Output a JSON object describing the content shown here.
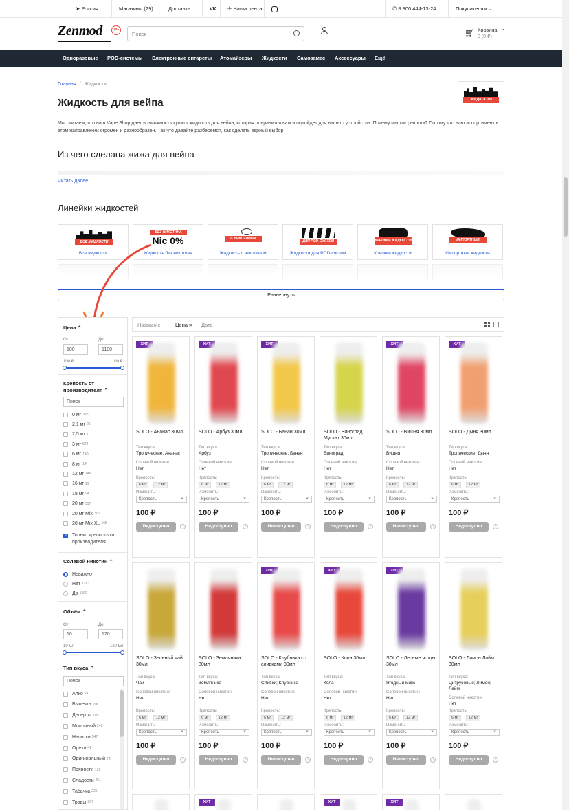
{
  "topbar": {
    "city": "Россия",
    "stores": "Магазины (29)",
    "delivery": "Доставка",
    "vk": "VK",
    "telegram": "Наша лента",
    "phone": "8 800 444-13-24",
    "buyers": "Покупателям"
  },
  "header": {
    "logo": "Zenmod",
    "age": "18+",
    "search_placeholder": "Поиск",
    "cart_label": "Корзина",
    "cart_sum": "0 (0 ₽)"
  },
  "nav": [
    "Одноразовые",
    "POD-системы",
    "Электронные сигареты",
    "Атомайзеры",
    "Жидкости",
    "Самозамес",
    "Аксессуары",
    "Ещё"
  ],
  "breadcrumb": {
    "home": "Главная",
    "sep": "/",
    "current": "Жидкости"
  },
  "category_badge": "ЖИДКОСТИ",
  "page_title": "Жидкость для вейпа",
  "intro": "Мы считаем, что наш Vape Shop дает возможность купить жидкость для вейпа, которая понравится вам и подойдет для вашего устройства. Почему мы так решили? Потому что наш ассортимент в этом направлении огромен и разнообразен. Так что давайте разберемся, как сделать верный выбор.",
  "section_heading": "Из чего сделана жижа для вейпа",
  "read_more": "Читать далее",
  "series_title": "Линейки жидкостей",
  "series": [
    {
      "label": "Все жидкости",
      "badge": "ВСЕ ЖИДКОСТИ"
    },
    {
      "label": "Жидкость без никотина",
      "badge": "БЕЗ НИКОТИНА",
      "big": "Nic 0%"
    },
    {
      "label": "Жидкость с никотином",
      "badge": "С НИКОТИНОМ"
    },
    {
      "label": "Жидкости для POD-систем",
      "badge": "ДЛЯ POD-СИСТЕМ"
    },
    {
      "label": "Крепкие жидкости",
      "badge": "КРЕПКИЕ ЖИДКОСТИ"
    },
    {
      "label": "Импортные жидкости",
      "badge": "ИМПОРТНЫЕ"
    }
  ],
  "expand_button": "Развернуть",
  "filters": {
    "price": {
      "title": "Цена",
      "from_label": "От",
      "to_label": "До",
      "from": "100",
      "to": "1100",
      "min_label": "100 ₽",
      "max_label": "1100 ₽"
    },
    "strength": {
      "title": "Крепость от производителя",
      "search_placeholder": "Поиск",
      "items": [
        {
          "label": "0 мг",
          "count": "325"
        },
        {
          "label": "2,1 мг",
          "count": "26"
        },
        {
          "label": "2,5 мг",
          "count": "1"
        },
        {
          "label": "3 мг",
          "count": "544"
        },
        {
          "label": "6 мг",
          "count": "140"
        },
        {
          "label": "8 мг",
          "count": "14"
        },
        {
          "label": "12 мг",
          "count": "146"
        },
        {
          "label": "16 мг",
          "count": "29"
        },
        {
          "label": "18 мг",
          "count": "94"
        },
        {
          "label": "20 мг",
          "count": "597"
        },
        {
          "label": "20 мг Mix",
          "count": "307"
        },
        {
          "label": "20 мг Mix XL",
          "count": "165"
        }
      ],
      "only_label": "Только крепость от производителя"
    },
    "salt": {
      "title": "Солевой никотин",
      "items": [
        {
          "label": "Неважно",
          "count": ""
        },
        {
          "label": "Нет",
          "count": "1283"
        },
        {
          "label": "Да",
          "count": "1290"
        }
      ]
    },
    "volume": {
      "title": "Объём",
      "from_label": "От",
      "to_label": "До",
      "from": "10",
      "to": "120",
      "min_label": "10 мл",
      "max_label": "120 мл"
    },
    "taste": {
      "title": "Тип вкуса",
      "search_placeholder": "Поиск",
      "items": [
        {
          "label": "Алко",
          "count": "24"
        },
        {
          "label": "Выпечка",
          "count": "206"
        },
        {
          "label": "Десерты",
          "count": "105"
        },
        {
          "label": "Молочный",
          "count": "242"
        },
        {
          "label": "Напитки",
          "count": "547"
        },
        {
          "label": "Орехи",
          "count": "41"
        },
        {
          "label": "Оригинальный",
          "count": "78"
        },
        {
          "label": "Пряности",
          "count": "139"
        },
        {
          "label": "Сладости",
          "count": "451"
        },
        {
          "label": "Табачка",
          "count": "225"
        },
        {
          "label": "Травы",
          "count": "307"
        }
      ]
    }
  },
  "sort": {
    "name": "Название",
    "price": "Цена",
    "date": "Дата"
  },
  "product_labels": {
    "taste": "Тип вкуса:",
    "salt": "Солевой никотин:",
    "strength": "Крепость:",
    "change": "Изменить:",
    "select": "Крепость",
    "unavailable": "Недоступно",
    "q": "?",
    "hit": "ХИТ"
  },
  "products_row1": [
    {
      "name": "SOLO - Ананас 30мл",
      "taste": "Тропические; Ананас",
      "salt": "Нет",
      "price": "100 ₽",
      "hit": true,
      "color": "#f0b63c"
    },
    {
      "name": "SOLO - Арбуз 30мл",
      "taste": "Арбуз",
      "salt": "Нет",
      "price": "100 ₽",
      "hit": true,
      "color": "#e0484f"
    },
    {
      "name": "SOLO - Банан 30мл",
      "taste": "Тропические; Банан",
      "salt": "Нет",
      "price": "100 ₽",
      "hit": true,
      "color": "#f2c84a"
    },
    {
      "name": "SOLO - Виноград Мускат 30мл",
      "taste": "Виноград",
      "salt": "Нет",
      "price": "100 ₽",
      "hit": false,
      "color": "#d6d44a"
    },
    {
      "name": "SOLO - Вишня 30мл",
      "taste": "Вишня",
      "salt": "Нет",
      "price": "100 ₽",
      "hit": true,
      "color": "#e04664"
    },
    {
      "name": "SOLO - Дыня 30мл",
      "taste": "Тропические; Дыня",
      "salt": "Нет",
      "price": "100 ₽",
      "hit": true,
      "color": "#f0a070"
    }
  ],
  "products_row2": [
    {
      "name": "SOLO - Зеленый чай 30мл",
      "taste": "Чай",
      "salt": "Нет",
      "price": "100 ₽",
      "hit": false,
      "color": "#c9a83a"
    },
    {
      "name": "SOLO - Земляника 30мл",
      "taste": "Земляника",
      "salt": "Нет",
      "price": "100 ₽",
      "hit": false,
      "color": "#d23a3a"
    },
    {
      "name": "SOLO - Клубника со сливками 30мл",
      "taste": "Сливки; Клубника",
      "salt": "Нет",
      "price": "100 ₽",
      "hit": true,
      "color": "#e84a4a"
    },
    {
      "name": "SOLO - Кола 30мл",
      "taste": "Кола",
      "salt": "Нет",
      "price": "100 ₽",
      "hit": true,
      "color": "#e8483a"
    },
    {
      "name": "SOLO - Лесные ягоды 30мл",
      "taste": "Ягодный микс",
      "salt": "Нет",
      "price": "100 ₽",
      "hit": true,
      "color": "#6a3aa0"
    },
    {
      "name": "SOLO - Лимон Лайм 30мл",
      "taste": "Цитрусовые; Лимон; Лайм",
      "salt": "Нет",
      "price": "100 ₽",
      "hit": false,
      "color": "#e6cf5a"
    }
  ],
  "row3_hits": [
    false,
    true,
    false,
    true,
    true,
    false
  ],
  "tags": [
    "6 мг",
    "12 мг"
  ],
  "colors": {
    "accent": "#2a5bd7",
    "nav": "#1f2933",
    "hit": "#6f2ba6",
    "arrow": "#e8483a"
  }
}
